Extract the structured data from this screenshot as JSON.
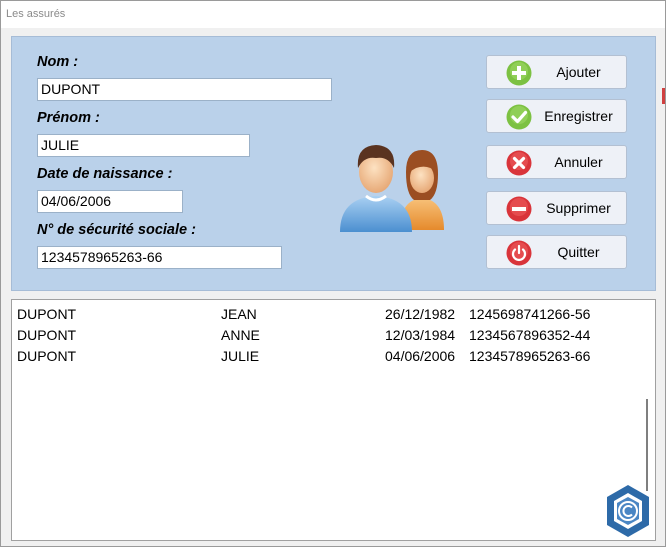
{
  "window": {
    "title": "Les assurés"
  },
  "form": {
    "nom_label": "Nom :",
    "nom_value": "DUPONT",
    "prenom_label": "Prénom :",
    "prenom_value": "JULIE",
    "naissance_label": "Date de naissance :",
    "naissance_value": "04/06/2006",
    "secu_label": "N° de sécurité sociale :",
    "secu_value": "1234578965263-66"
  },
  "buttons": {
    "ajouter": "Ajouter",
    "enregistrer": "Enregistrer",
    "annuler": "Annuler",
    "supprimer": "Supprimer",
    "quitter": "Quitter"
  },
  "icons": {
    "ajouter": "plus-circle-icon",
    "enregistrer": "check-circle-icon",
    "annuler": "x-circle-icon",
    "supprimer": "minus-circle-icon",
    "quitter": "power-icon",
    "illustration": "users-icon",
    "logo": "copyright-hexagon-icon"
  },
  "colors": {
    "panel": "#bad1ea",
    "add": "#7cc142",
    "save": "#7cc142",
    "cancel": "#d9343a",
    "delete": "#d9343a",
    "quit": "#d9343a"
  },
  "list": {
    "rows": [
      [
        "DUPONT",
        "JEAN",
        "26/12/1982",
        "1245698741266-56"
      ],
      [
        "DUPONT",
        "ANNE",
        "12/03/1984",
        "1234567896352-44"
      ],
      [
        "DUPONT",
        "JULIE",
        "04/06/2006",
        "1234578965263-66"
      ]
    ]
  }
}
